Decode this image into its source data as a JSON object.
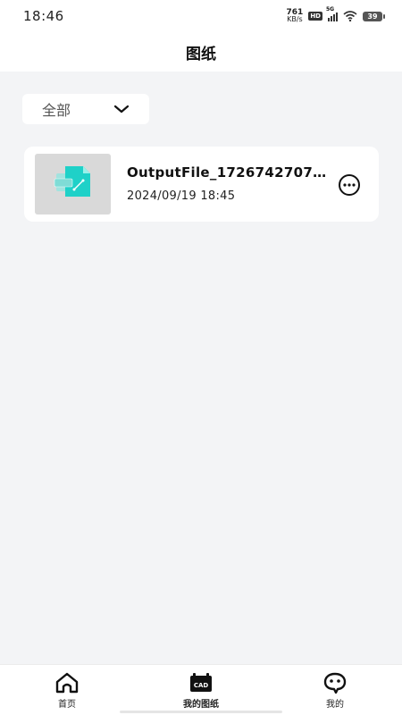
{
  "status_bar": {
    "time": "18:46",
    "net_speed_value": "761",
    "net_speed_unit": "KB/s",
    "hd_label": "HD",
    "network_label": "5G",
    "battery": "39"
  },
  "header": {
    "title": "图纸"
  },
  "filter": {
    "selected": "全部"
  },
  "files": [
    {
      "name": "OutputFile_17267427073…",
      "date": "2024/09/19 18:45"
    }
  ],
  "bottom_nav": {
    "items": [
      {
        "label": "首页",
        "icon": "home-icon"
      },
      {
        "label": "我的图纸",
        "icon": "cad-icon",
        "icon_text": "CAD",
        "active": true
      },
      {
        "label": "我的",
        "icon": "profile-icon"
      }
    ]
  },
  "colors": {
    "accent": "#1fd1c8",
    "background": "#f3f4f6",
    "card": "#ffffff"
  }
}
